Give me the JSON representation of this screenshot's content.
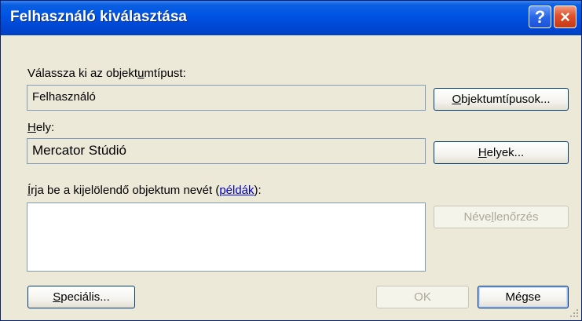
{
  "window": {
    "title": "Felhasználó kiválasztása",
    "help_glyph": "?",
    "close_glyph": "×"
  },
  "object_type": {
    "label_pre": "Válassza ki az objekt",
    "label_accel": "u",
    "label_post": "mtípust:",
    "value": "Felhasználó",
    "button_accel": "O",
    "button_rest": "bjektumtípusok..."
  },
  "location": {
    "label_accel": "H",
    "label_post": "ely:",
    "value": "Mercator Stúdió",
    "button_accel": "H",
    "button_rest": "elyek..."
  },
  "names": {
    "label_accel": "Í",
    "label_mid": "rja be a kijelölendő objektum nevét (",
    "link_text": "példák",
    "label_end": "):",
    "value": "",
    "check_pre": "Néve",
    "check_accel": "l",
    "check_post": "lenőrzés"
  },
  "footer": {
    "advanced_accel": "S",
    "advanced_rest": "peciális...",
    "ok_label": "OK",
    "cancel_label": "Mégse"
  }
}
